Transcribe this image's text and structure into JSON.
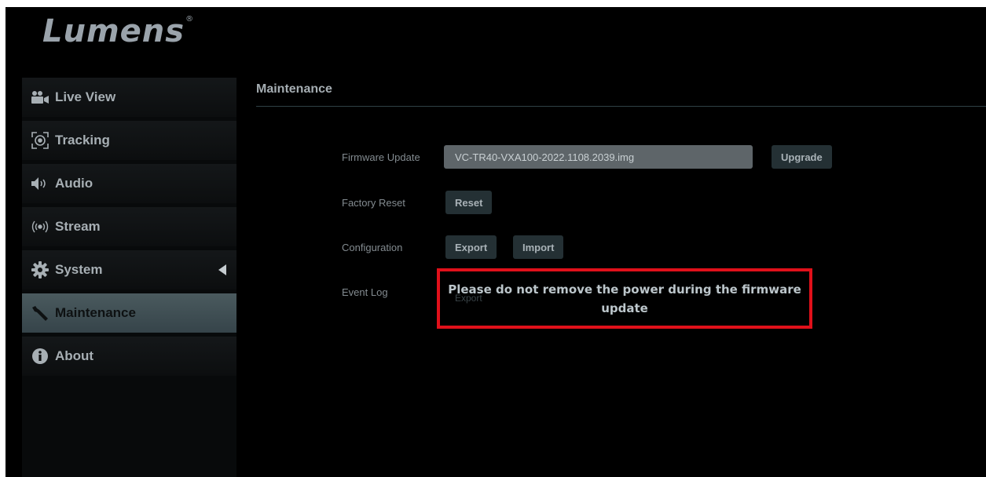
{
  "brand": {
    "logo": "Lumens",
    "reg_mark": "®"
  },
  "sidebar": {
    "items": [
      {
        "label": "Live View",
        "icon": "video-camera-icon",
        "active": false
      },
      {
        "label": "Tracking",
        "icon": "tracking-target-icon",
        "active": false
      },
      {
        "label": "Audio",
        "icon": "speaker-icon",
        "active": false
      },
      {
        "label": "Stream",
        "icon": "broadcast-icon",
        "active": false
      },
      {
        "label": "System",
        "icon": "gear-icon",
        "active": false,
        "expandable": true
      },
      {
        "label": "Maintenance",
        "icon": "wrench-icon",
        "active": true
      },
      {
        "label": "About",
        "icon": "info-icon",
        "active": false
      }
    ]
  },
  "main": {
    "title": "Maintenance",
    "firmware": {
      "label": "Firmware Update",
      "value": "VC-TR40-VXA100-2022.1108.2039.img",
      "button": "Upgrade"
    },
    "factory_reset": {
      "label": "Factory Reset",
      "button": "Reset"
    },
    "configuration": {
      "label": "Configuration",
      "export_button": "Export",
      "import_button": "Import"
    },
    "event_log": {
      "label": "Event Log",
      "button": "Export"
    }
  },
  "warning": {
    "message": "Please do not remove the power during the firmware update",
    "border_color": "#e0101a"
  },
  "colors": {
    "background": "#000000",
    "active_item": "#44545a",
    "button": "#243034"
  }
}
